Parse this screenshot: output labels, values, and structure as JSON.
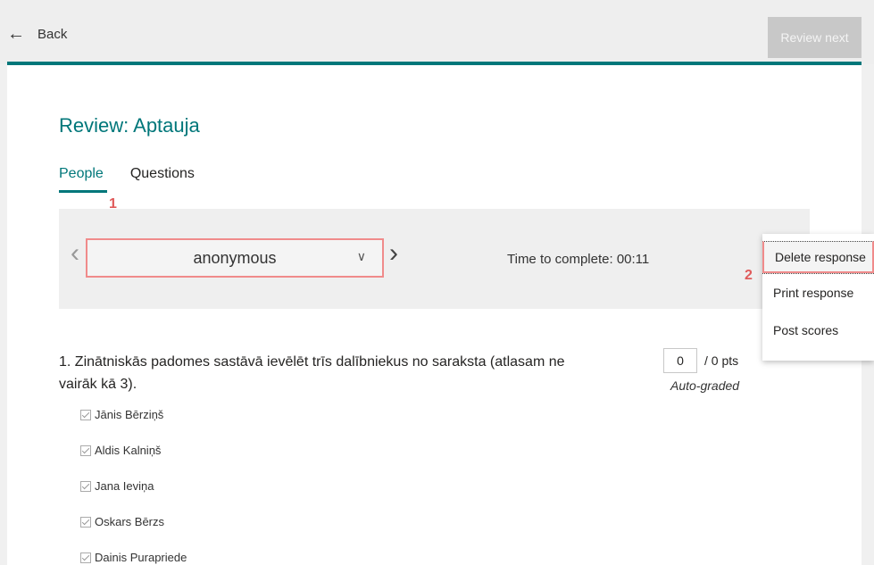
{
  "header": {
    "back_label": "Back",
    "review_next_label": "Review next"
  },
  "title": "Review: Aptauja",
  "tabs": [
    {
      "label": "People"
    },
    {
      "label": "Questions"
    }
  ],
  "annotations": {
    "one": "1",
    "two": "2"
  },
  "respondent": {
    "selected": "anonymous",
    "time_to_complete": "Time to complete: 00:11"
  },
  "menu": {
    "items": [
      {
        "label": "Delete response"
      },
      {
        "label": "Print response"
      },
      {
        "label": "Post scores"
      }
    ]
  },
  "question": {
    "text": "1. Zinātniskās padomes sastāvā ievēlēt trīs dalībniekus no saraksta (atlasam ne vairāk kā 3).",
    "score": "0",
    "score_suffix": "/ 0 pts",
    "grading": "Auto-graded",
    "options": [
      {
        "label": "Jānis Bērziņš"
      },
      {
        "label": "Aldis Kalniņš"
      },
      {
        "label": "Jana Ieviņa"
      },
      {
        "label": "Oskars Bērzs"
      },
      {
        "label": "Dainis Purapriede"
      }
    ]
  },
  "colors": {
    "accent": "#00777a",
    "highlight": "#f08b8b",
    "annotation": "#e05a5a"
  },
  "icons": [
    "back-arrow-icon",
    "chevron-left-icon",
    "chevron-right-icon",
    "chevron-down-icon",
    "comment-icon",
    "more-options-icon",
    "checkbox-icon"
  ]
}
